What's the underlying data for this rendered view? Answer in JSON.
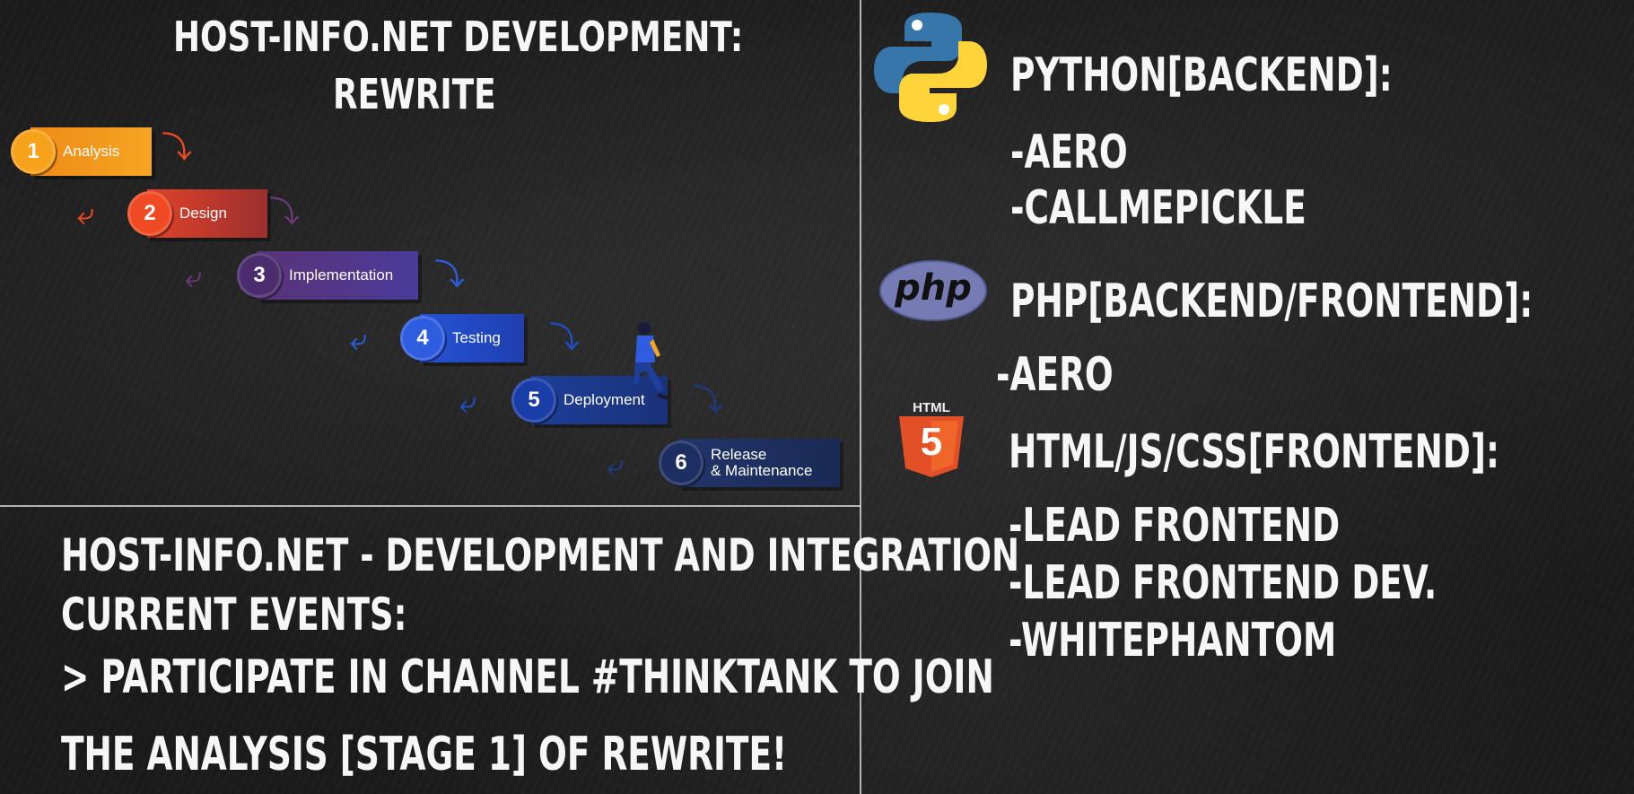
{
  "header": {
    "title_line1": "HOST-INFO.NET DEVELOPMENT:",
    "title_line2": "REWRITE"
  },
  "process_steps": [
    {
      "number": "1",
      "label": "Analysis",
      "color": "#f7941d",
      "circle_color": "#f7a51d"
    },
    {
      "number": "2",
      "label": "Design",
      "color": "#c0392b",
      "circle_color": "#ef4a23"
    },
    {
      "number": "3",
      "label": "Implementation",
      "color": "#5b3a8c",
      "circle_color": "#4b2c6e"
    },
    {
      "number": "4",
      "label": "Testing",
      "color": "#1f4fc9",
      "circle_color": "#2f5de0"
    },
    {
      "number": "5",
      "label": "Deployment",
      "color": "#1d3f9a",
      "circle_color": "#1a3ea8"
    },
    {
      "number": "6",
      "label_line1": "Release",
      "label_line2": "& Maintenance",
      "color": "#1e3160",
      "circle_color": "#1c2e62"
    }
  ],
  "announcement": {
    "line1": "HOST-INFO.NET - DEVELOPMENT AND INTEGRATION",
    "line2": "CURRENT EVENTS:",
    "line3": "> PARTICIPATE IN CHANNEL #THINKTANK TO JOIN",
    "line4": "THE ANALYSIS [STAGE 1] OF REWRITE!"
  },
  "teams": {
    "python": {
      "icon": "python-logo",
      "heading": "PYTHON[BACKEND]:",
      "members": [
        "-AERO",
        "-CALLMEPICKLE"
      ]
    },
    "php": {
      "icon": "php-logo",
      "logo_text": "php",
      "heading": "PHP[BACKEND/FRONTEND]:",
      "members": [
        "-AERO"
      ]
    },
    "html": {
      "icon": "html5-logo",
      "logo_text": "HTML",
      "logo_number": "5",
      "heading": "HTML/JS/CSS[FRONTEND]:",
      "members": [
        "-LEAD FRONTEND",
        "-LEAD FRONTEND DEV.",
        "-WHITEPHANTOM"
      ]
    }
  }
}
